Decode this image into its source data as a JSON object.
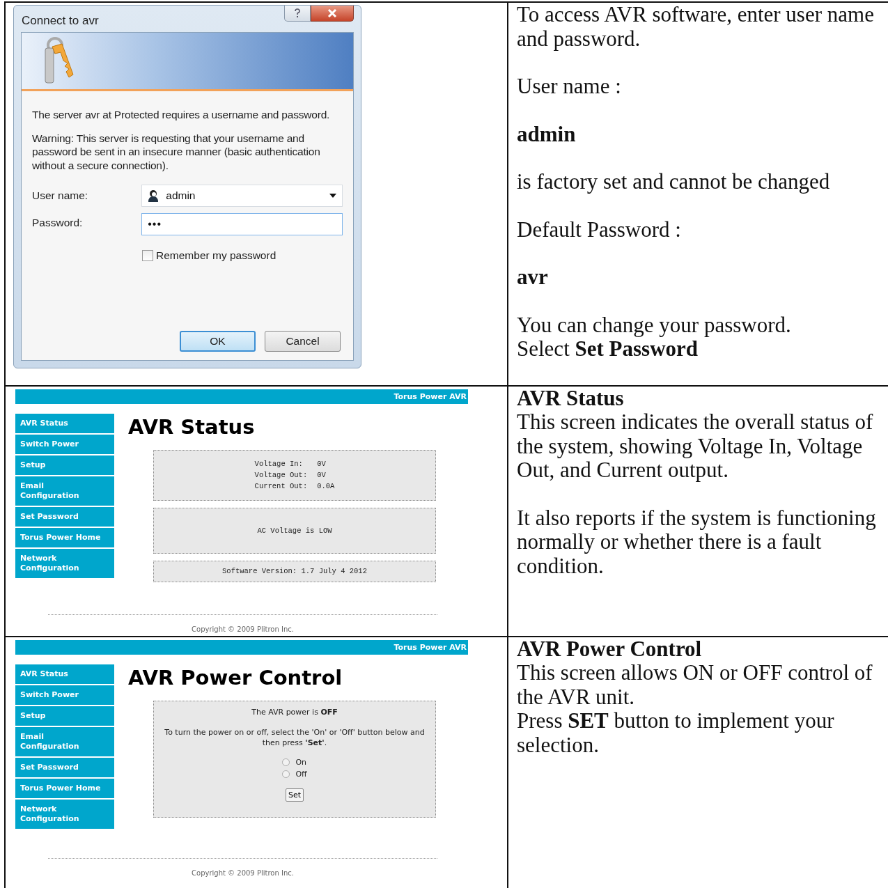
{
  "rows": [
    {
      "screen": {
        "kind": "login_dialog",
        "title": "Connect to avr",
        "message": "The server avr at Protected requires a username and password.",
        "warning": "Warning: This server is requesting that your username and password be sent in an insecure manner (basic authentication without a secure connection).",
        "fields": [
          {
            "kind": "combo",
            "label": "User name:",
            "value": "admin"
          },
          {
            "kind": "password",
            "label": "Password:",
            "value": "•••"
          }
        ],
        "remember": {
          "label": "Remember my password",
          "checked": false
        },
        "buttons": [
          {
            "label": "OK",
            "default": true
          },
          {
            "label": "Cancel",
            "default": false
          }
        ]
      },
      "notes": [
        [
          {
            "kind": "plain",
            "text": "To access AVR software, enter user name and password."
          }
        ],
        [
          {
            "kind": "plain",
            "text": "User name :"
          }
        ],
        [
          {
            "kind": "strong",
            "text": "admin"
          }
        ],
        [
          {
            "kind": "plain",
            "text": "is factory set and cannot be changed"
          }
        ],
        [
          {
            "kind": "plain",
            "text": "Default Password :"
          }
        ],
        [
          {
            "kind": "strong",
            "text": "avr"
          }
        ],
        [
          {
            "kind": "plain",
            "text": "You can change your password."
          },
          {
            "kind": "plain",
            "text": "Select **Set Password**"
          }
        ]
      ]
    },
    {
      "screen": {
        "kind": "status_page",
        "brand": "Torus Power AVR",
        "nav": [
          "AVR Status",
          "Switch Power",
          "Setup",
          "Email Configuration",
          "Set Password",
          "Torus Power Home",
          "Network Configuration"
        ],
        "heading": "AVR Status",
        "readings": [
          {
            "label": "Voltage In:",
            "value": "0V"
          },
          {
            "label": "Voltage Out:",
            "value": "0V"
          },
          {
            "label": "Current Out:",
            "value": "0.0A"
          }
        ],
        "alert": "AC Voltage is LOW",
        "version": "Software Version: 1.7 July 4 2012",
        "footer": "Copyright © 2009 Plitron Inc."
      },
      "notes": [
        [
          {
            "kind": "strong",
            "text": "AVR Status"
          },
          {
            "kind": "plain",
            "text": "This screen indicates the overall status of the system, showing Voltage In, Voltage Out, and Current output."
          }
        ],
        [
          {
            "kind": "plain",
            "text": "It also reports if the system is functioning normally or whether there is a fault condition."
          }
        ]
      ]
    },
    {
      "screen": {
        "kind": "power_page",
        "brand": "Torus Power AVR",
        "nav": [
          "AVR Status",
          "Switch Power",
          "Setup",
          "Email Configuration",
          "Set Password",
          "Torus Power Home",
          "Network Configuration"
        ],
        "heading": "AVR Power Control",
        "state_line": "The AVR power is **OFF**",
        "instructions": "To turn the power on or off, select the 'On' or 'Off' button below and then press **'Set'**.",
        "options": [
          {
            "label": "On",
            "selected": false
          },
          {
            "label": "Off",
            "selected": false
          }
        ],
        "submit": "Set",
        "footer": "Copyright © 2009 Plitron Inc."
      },
      "notes": [
        [
          {
            "kind": "strong",
            "text": "AVR Power Control"
          },
          {
            "kind": "plain",
            "text": "This screen allows ON or OFF control of the AVR unit."
          },
          {
            "kind": "plain",
            "text": "Press **SET** button to implement your selection."
          }
        ]
      ]
    }
  ]
}
